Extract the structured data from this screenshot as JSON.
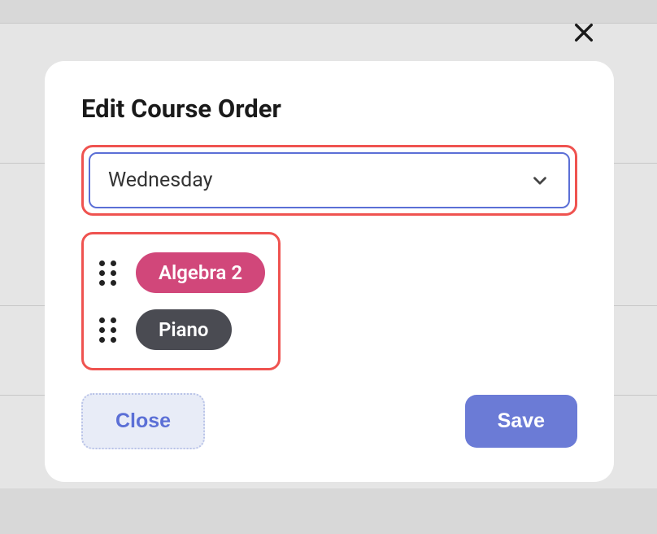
{
  "modal": {
    "title": "Edit Course Order",
    "day_selector": {
      "selected": "Wednesday"
    },
    "courses": [
      {
        "name": "Algebra 2",
        "color": "#d1477a"
      },
      {
        "name": "Piano",
        "color": "#4a4b52"
      }
    ],
    "buttons": {
      "close": "Close",
      "save": "Save"
    }
  }
}
